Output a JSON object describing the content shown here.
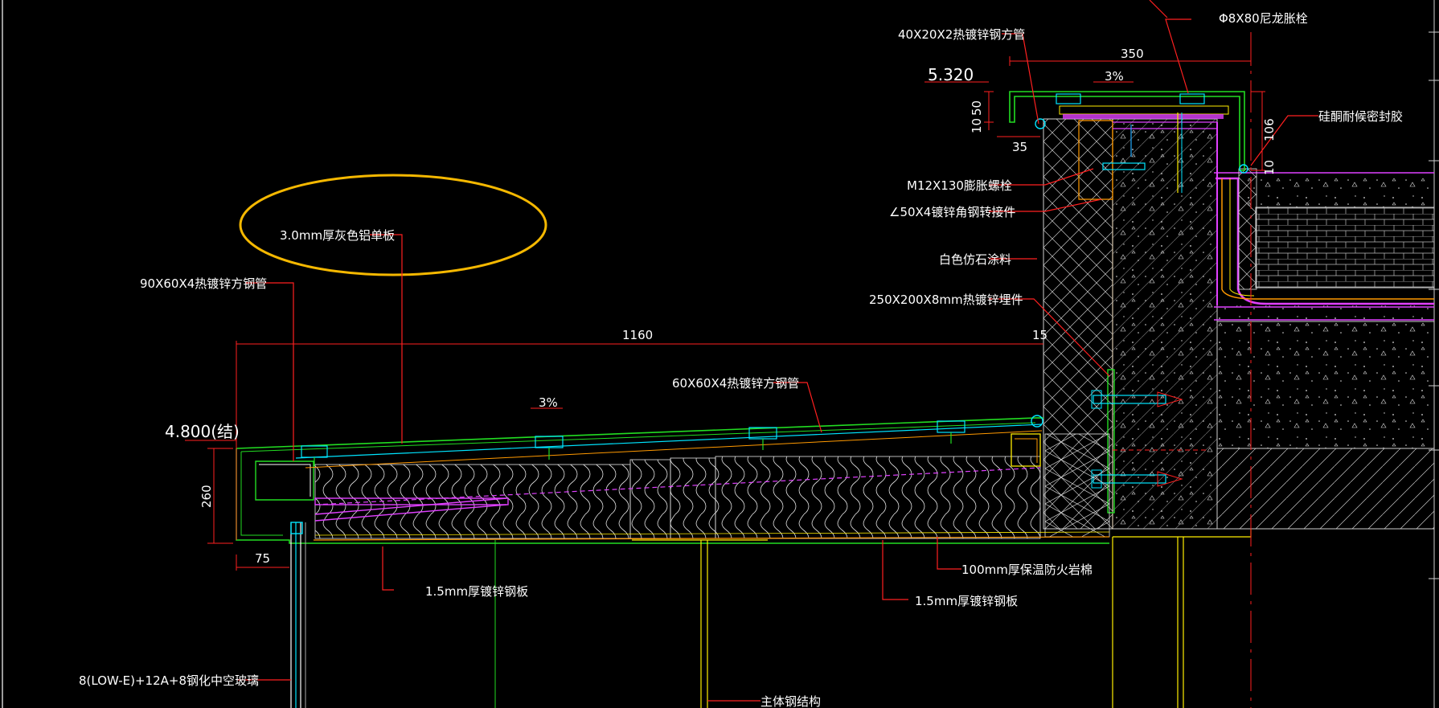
{
  "drawing": {
    "levels": {
      "roof_top": "5.320",
      "structure": "4.800(结)"
    },
    "slopes": {
      "parapet_cap": "3%",
      "canopy": "3%"
    },
    "dimensions": {
      "cap_width": "350",
      "cap_10": "10",
      "cap_50": "50",
      "cap_35": "35",
      "right_106": "106",
      "right_10": "10",
      "canopy_span": "1160",
      "canopy_gap": "15",
      "canopy_depth": "260",
      "canopy_edge": "75"
    },
    "labels": {
      "tube_40x20": "40X20X2热镀锌钢方管",
      "anchor_phi8": "Φ8X80尼龙胀栓",
      "silicone_sealant": "硅酮耐候密封胶",
      "bolt_m12": "M12X130膨胀螺栓",
      "angle_50x4": "∠50X4镀锌角钢转接件",
      "white_coating": "白色仿石涂料",
      "embed_plate": "250X200X8mm热镀锌埋件",
      "aluminum_panel": "3.0mm厚灰色铝单板",
      "tube_90x60": "90X60X4热镀锌方钢管",
      "tube_60x60": "60X60X4热镀锌方钢管",
      "rockwool": "100mm厚保温防火岩棉",
      "steel_sheet_left": "1.5mm厚镀锌钢板",
      "steel_sheet_right": "1.5mm厚镀锌钢板",
      "glass": "8(LOW-E)+12A+8钢化中空玻璃",
      "main_structure": "主体钢结构"
    },
    "colors": {
      "leader": "#ff2020",
      "panel_green": "#22dd22",
      "steel_cyan": "#00e5ff",
      "magenta": "#e040ff",
      "yellow": "#ffee00",
      "orange": "#ff9900",
      "highlight_ellipse": "#f5b800"
    }
  }
}
